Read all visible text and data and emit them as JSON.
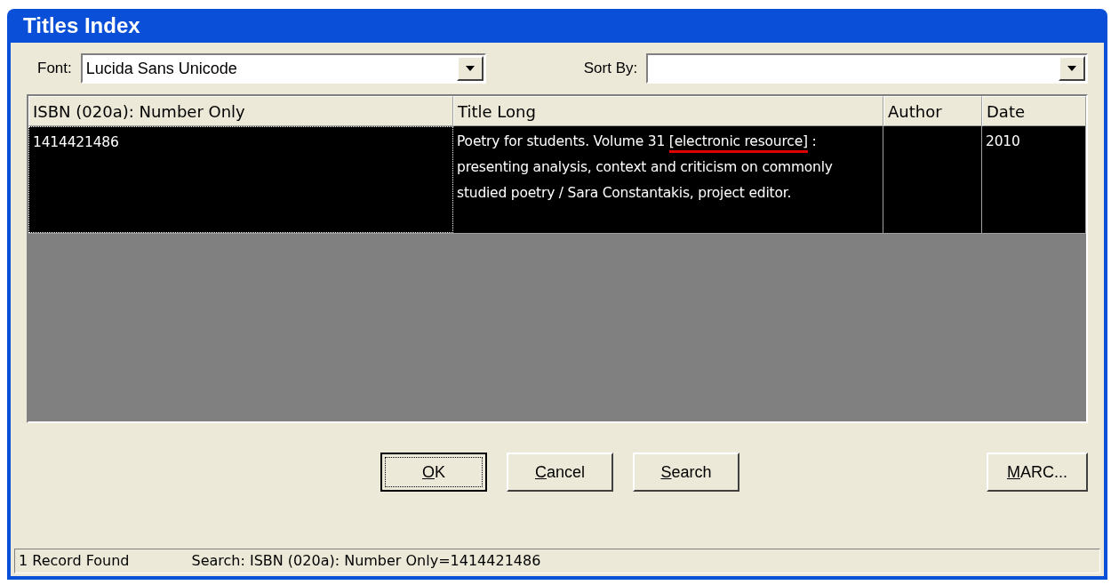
{
  "window": {
    "title": "Titles Index"
  },
  "font": {
    "label": "Font:",
    "value": "Lucida Sans Unicode"
  },
  "sort_by": {
    "label": "Sort By:"
  },
  "table": {
    "columns": [
      "ISBN (020a): Number Only",
      "Title Long",
      "Author",
      "Date"
    ],
    "rows": [
      {
        "selected": true,
        "cells": [
          [
            {
              "text": "1414421486",
              "marked": false
            }
          ],
          [
            {
              "text": "Poetry for students. Volume 31 ",
              "marked": false
            },
            {
              "text": "[electronic resource]",
              "marked": true
            },
            {
              "text": " : presenting analysis, context and criticism on commonly studied poetry / Sara Constantakis, project editor.",
              "marked": false
            }
          ],
          [],
          [
            {
              "text": "2010",
              "marked": false
            }
          ]
        ]
      }
    ]
  },
  "buttons": [
    {
      "mnemonic": "O",
      "rest": "K",
      "default": true
    },
    {
      "mnemonic": "C",
      "rest": "ancel",
      "default": false
    },
    {
      "mnemonic": "S",
      "rest": "earch",
      "default": false
    }
  ],
  "side_button": {
    "mnemonic": "M",
    "rest": "ARC...",
    "default": false
  },
  "status_bar": [
    "1 Record Found",
    "Search: ISBN (020a): Number Only=1414421486"
  ]
}
